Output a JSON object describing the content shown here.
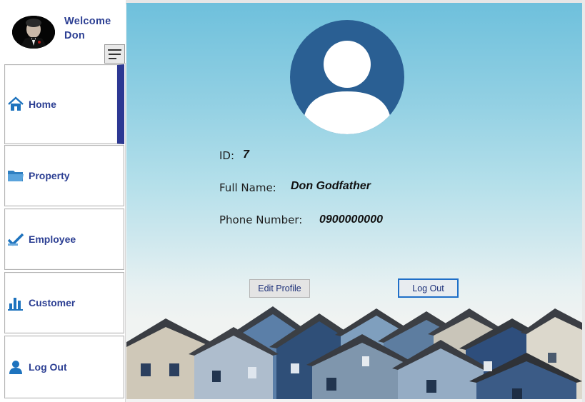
{
  "sidebar": {
    "welcome_line1": "Welcome",
    "welcome_line2": "Don",
    "items": [
      {
        "label": "Home",
        "icon": "home-icon",
        "active": true
      },
      {
        "label": "Property",
        "icon": "folder-icon"
      },
      {
        "label": "Employee",
        "icon": "checkmark-icon"
      },
      {
        "label": "Customer",
        "icon": "bar-chart-icon"
      },
      {
        "label": "Log Out",
        "icon": "user-icon"
      }
    ]
  },
  "profile": {
    "id_label": "ID:",
    "id_value": "7",
    "name_label": "Full Name:",
    "name_value": "Don Godfather",
    "phone_label": "Phone Number:",
    "phone_value": "0900000000"
  },
  "actions": {
    "edit_label": "Edit Profile",
    "logout_label": "Log Out"
  },
  "colors": {
    "accent": "#2c3f93",
    "avatar_bg": "#2a5f93",
    "active_bar": "#2c3893",
    "logout_border": "#1f6fc8"
  }
}
